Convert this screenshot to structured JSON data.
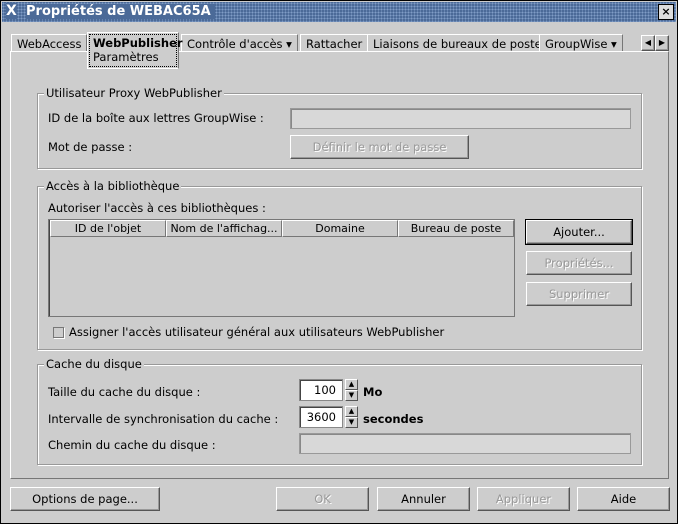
{
  "window": {
    "title": "Propriétés de WEBAC65A",
    "close": "×",
    "icon": "X"
  },
  "tabs": [
    {
      "label": "WebAccess"
    },
    {
      "label": "WebPublisher",
      "sub": "Paramètres"
    },
    {
      "label": "Contrôle d'accès ▾"
    },
    {
      "label": "Rattacher"
    },
    {
      "label": "Liaisons de bureaux de poste"
    },
    {
      "label": "GroupWise ▾"
    }
  ],
  "tab_scroll": {
    "left": "◀",
    "right": "▶"
  },
  "proxy": {
    "title": "Utilisateur Proxy WebPublisher",
    "mailbox_label": "ID de la boîte aux lettres GroupWise :",
    "mailbox_value": "",
    "password_label": "Mot de passe :",
    "set_password": "Définir le mot de passe"
  },
  "library": {
    "title": "Accès à la bibliothèque",
    "allow_label": "Autoriser l'accès à ces bibliothèques :",
    "columns": [
      "ID de l'objet",
      "Nom de l'affichag...",
      "Domaine",
      "Bureau de poste"
    ],
    "rows": [],
    "add": "Ajouter...",
    "properties": "Propriétés...",
    "delete": "Supprimer",
    "checkbox_label": "Assigner l'accès utilisateur général aux utilisateurs WebPublisher",
    "checkbox_checked": false
  },
  "cache": {
    "title": "Cache du disque",
    "size_label": "Taille du cache du disque :",
    "size_value": "100",
    "size_unit": "Mo",
    "sync_label": "Intervalle de synchronisation du cache :",
    "sync_value": "3600",
    "sync_unit": "secondes",
    "path_label": "Chemin du cache du disque :",
    "path_value": ""
  },
  "buttons": {
    "page_options": "Options de page...",
    "ok": "OK",
    "cancel": "Annuler",
    "apply": "Appliquer",
    "help": "Aide"
  }
}
